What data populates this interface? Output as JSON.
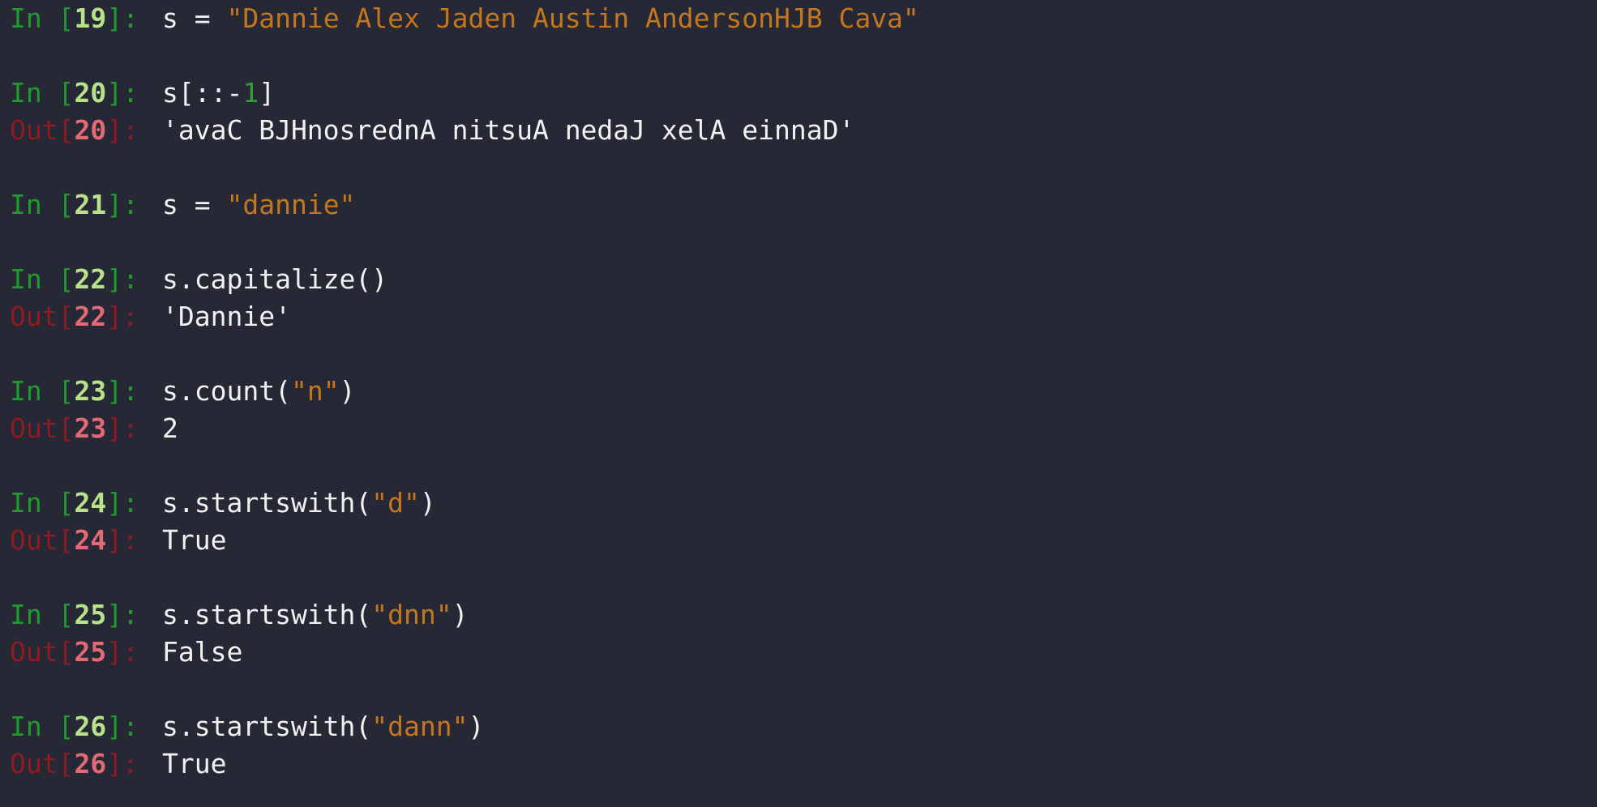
{
  "colors": {
    "background": "#262835",
    "in_prompt": "#1f9b2a",
    "in_number": "#b8e28a",
    "out_prompt": "#8e1b22",
    "out_number": "#e26a74",
    "string": "#c5761c",
    "code": "#f1f1f1"
  },
  "cells": [
    {
      "in_word": "In",
      "lb": "[",
      "num": "19",
      "rb": "]",
      "colon": ": ",
      "code": [
        {
          "t": "s = ",
          "k": "code"
        },
        {
          "t": "\"Dannie Alex Jaden Austin AndersonHJB Cava\"",
          "k": "str"
        }
      ]
    },
    {
      "in_word": "In",
      "lb": "[",
      "num": "20",
      "rb": "]",
      "colon": ": ",
      "code": [
        {
          "t": "s[::-",
          "k": "code"
        },
        {
          "t": "1",
          "k": "num"
        },
        {
          "t": "]",
          "k": "code"
        }
      ],
      "out_word": "Out",
      "out_lb": "[",
      "out_num": "20",
      "out_rb": "]",
      "out_colon": ": ",
      "output": "'avaC BJHnosrednA nitsuA nedaJ xelA einnaD'"
    },
    {
      "in_word": "In",
      "lb": "[",
      "num": "21",
      "rb": "]",
      "colon": ": ",
      "code": [
        {
          "t": "s = ",
          "k": "code"
        },
        {
          "t": "\"dannie\"",
          "k": "str"
        }
      ]
    },
    {
      "in_word": "In",
      "lb": "[",
      "num": "22",
      "rb": "]",
      "colon": ": ",
      "code": [
        {
          "t": "s.capitalize()",
          "k": "code"
        }
      ],
      "out_word": "Out",
      "out_lb": "[",
      "out_num": "22",
      "out_rb": "]",
      "out_colon": ": ",
      "output": "'Dannie'"
    },
    {
      "in_word": "In",
      "lb": "[",
      "num": "23",
      "rb": "]",
      "colon": ": ",
      "code": [
        {
          "t": "s.count(",
          "k": "code"
        },
        {
          "t": "\"n\"",
          "k": "str"
        },
        {
          "t": ")",
          "k": "code"
        }
      ],
      "out_word": "Out",
      "out_lb": "[",
      "out_num": "23",
      "out_rb": "]",
      "out_colon": ": ",
      "output": "2"
    },
    {
      "in_word": "In",
      "lb": "[",
      "num": "24",
      "rb": "]",
      "colon": ": ",
      "code": [
        {
          "t": "s.startswith(",
          "k": "code"
        },
        {
          "t": "\"d\"",
          "k": "str"
        },
        {
          "t": ")",
          "k": "code"
        }
      ],
      "out_word": "Out",
      "out_lb": "[",
      "out_num": "24",
      "out_rb": "]",
      "out_colon": ": ",
      "output": "True"
    },
    {
      "in_word": "In",
      "lb": "[",
      "num": "25",
      "rb": "]",
      "colon": ": ",
      "code": [
        {
          "t": "s.startswith(",
          "k": "code"
        },
        {
          "t": "\"dnn\"",
          "k": "str"
        },
        {
          "t": ")",
          "k": "code"
        }
      ],
      "out_word": "Out",
      "out_lb": "[",
      "out_num": "25",
      "out_rb": "]",
      "out_colon": ": ",
      "output": "False"
    },
    {
      "in_word": "In",
      "lb": "[",
      "num": "26",
      "rb": "]",
      "colon": ": ",
      "code": [
        {
          "t": "s.startswith(",
          "k": "code"
        },
        {
          "t": "\"dann\"",
          "k": "str"
        },
        {
          "t": ")",
          "k": "code"
        }
      ],
      "out_word": "Out",
      "out_lb": "[",
      "out_num": "26",
      "out_rb": "]",
      "out_colon": ": ",
      "output": "True"
    }
  ]
}
